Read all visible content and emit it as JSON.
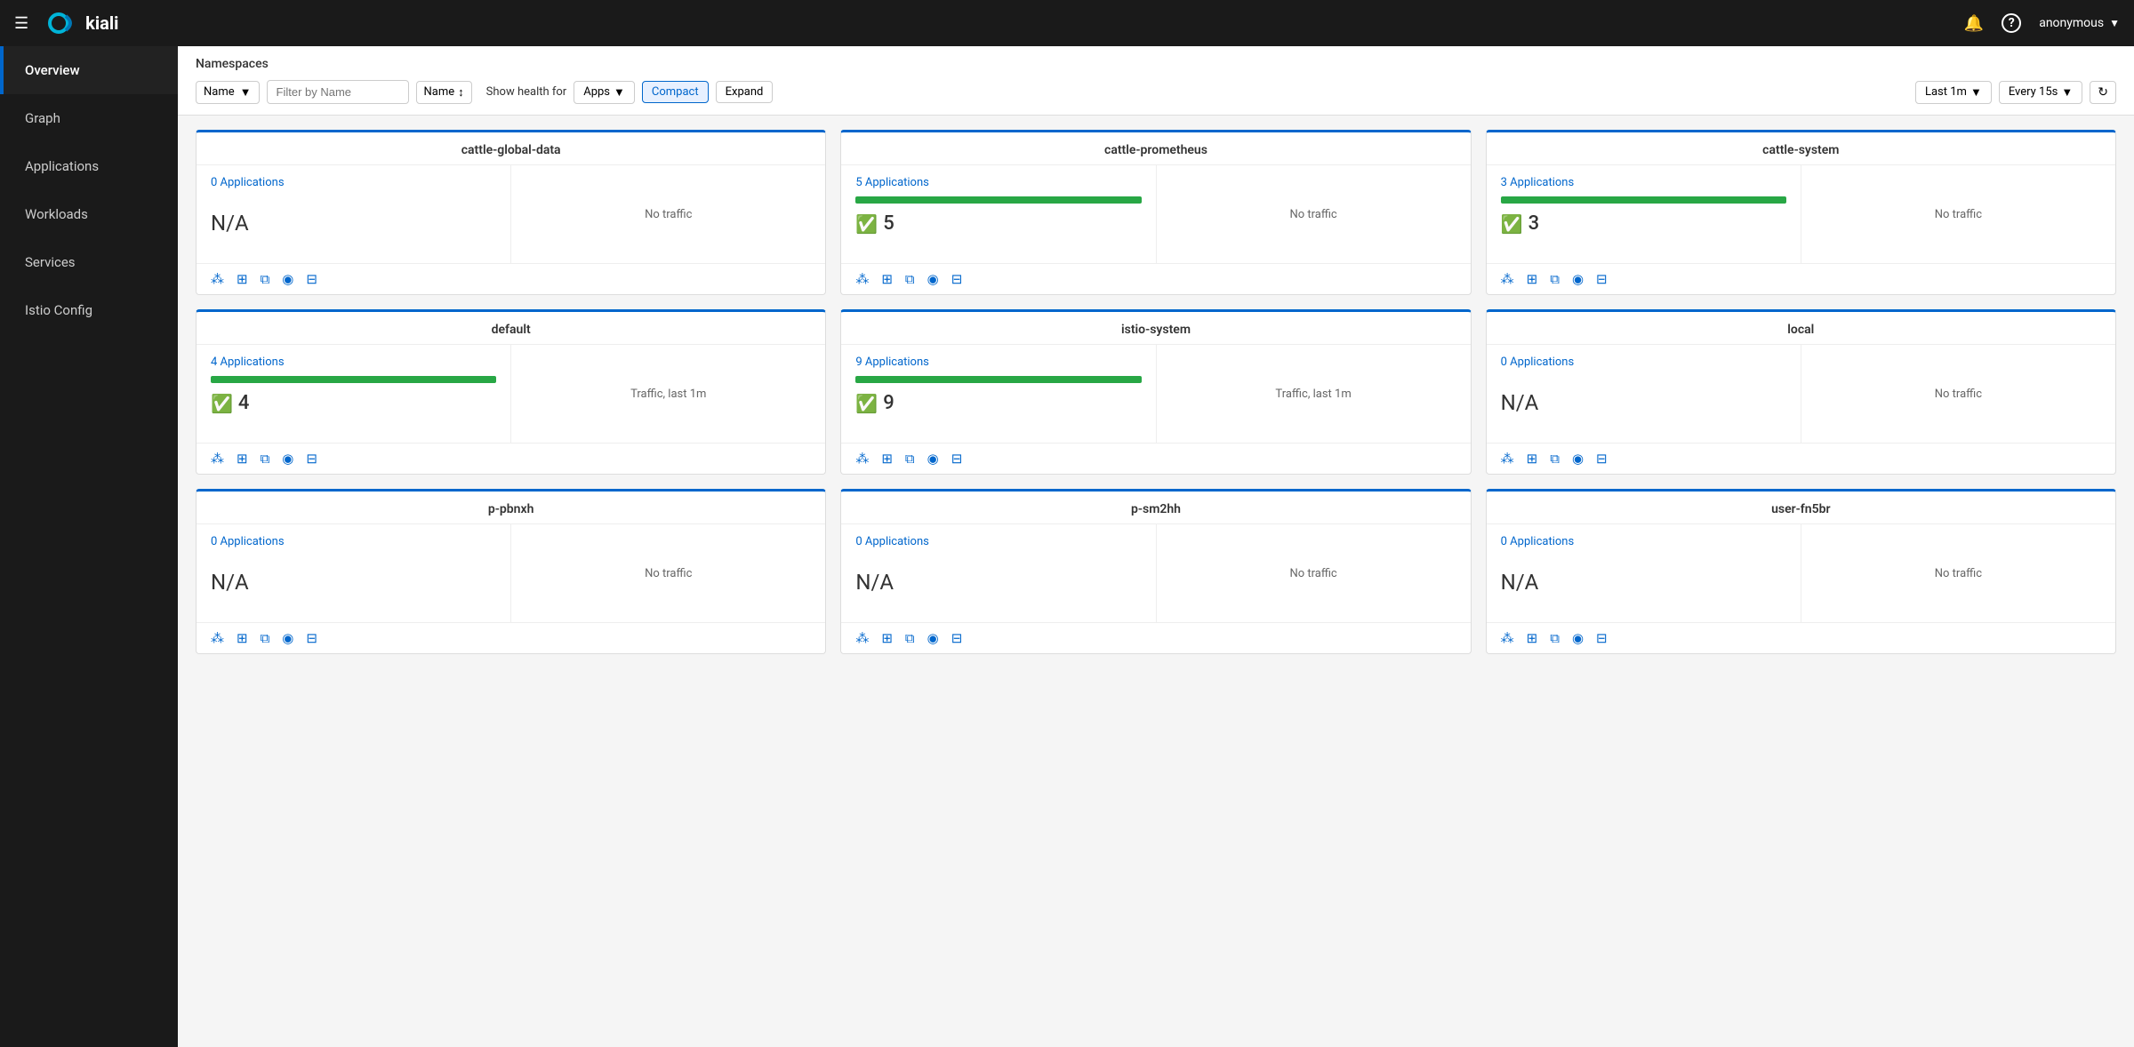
{
  "navbar": {
    "brand": "kiali",
    "user": "anonymous"
  },
  "sidebar": {
    "items": [
      {
        "id": "overview",
        "label": "Overview",
        "active": true
      },
      {
        "id": "graph",
        "label": "Graph",
        "active": false
      },
      {
        "id": "applications",
        "label": "Applications",
        "active": false
      },
      {
        "id": "workloads",
        "label": "Workloads",
        "active": false
      },
      {
        "id": "services",
        "label": "Services",
        "active": false
      },
      {
        "id": "istio-config",
        "label": "Istio Config",
        "active": false
      }
    ]
  },
  "toolbar": {
    "namespaces_label": "Namespaces",
    "filter_by": "Name",
    "filter_placeholder": "Filter by Name",
    "sort_label": "Name",
    "health_label": "Show health for",
    "health_for": "Apps",
    "compact_label": "Compact",
    "expand_label": "Expand",
    "time_range": "Last 1m",
    "refresh_interval": "Every 15s"
  },
  "namespaces": [
    {
      "name": "cattle-global-data",
      "app_count": 0,
      "app_count_label": "0 Applications",
      "health_bar": false,
      "health_value": null,
      "na": true,
      "traffic": "No traffic"
    },
    {
      "name": "cattle-prometheus",
      "app_count": 5,
      "app_count_label": "5 Applications",
      "health_bar": true,
      "health_value": 5,
      "na": false,
      "traffic": "No traffic"
    },
    {
      "name": "cattle-system",
      "app_count": 3,
      "app_count_label": "3 Applications",
      "health_bar": true,
      "health_value": 3,
      "na": false,
      "traffic": "No traffic"
    },
    {
      "name": "default",
      "app_count": 4,
      "app_count_label": "4 Applications",
      "health_bar": true,
      "health_value": 4,
      "na": false,
      "traffic": "Traffic, last 1m"
    },
    {
      "name": "istio-system",
      "app_count": 9,
      "app_count_label": "9 Applications",
      "health_bar": true,
      "health_value": 9,
      "na": false,
      "traffic": "Traffic, last 1m"
    },
    {
      "name": "local",
      "app_count": 0,
      "app_count_label": "0 Applications",
      "health_bar": false,
      "health_value": null,
      "na": true,
      "traffic": "No traffic"
    },
    {
      "name": "p-pbnxh",
      "app_count": 0,
      "app_count_label": "0 Applications",
      "health_bar": false,
      "health_value": null,
      "na": true,
      "traffic": "No traffic"
    },
    {
      "name": "p-sm2hh",
      "app_count": 0,
      "app_count_label": "0 Applications",
      "health_bar": false,
      "health_value": null,
      "na": true,
      "traffic": "No traffic"
    },
    {
      "name": "user-fn5br",
      "app_count": 0,
      "app_count_label": "0 Applications",
      "health_bar": false,
      "health_value": null,
      "na": true,
      "traffic": "No traffic"
    }
  ],
  "icons": {
    "graph": "⊕",
    "workloads": "⊞",
    "apps": "⧉",
    "eye": "◉",
    "config": "⊟"
  }
}
